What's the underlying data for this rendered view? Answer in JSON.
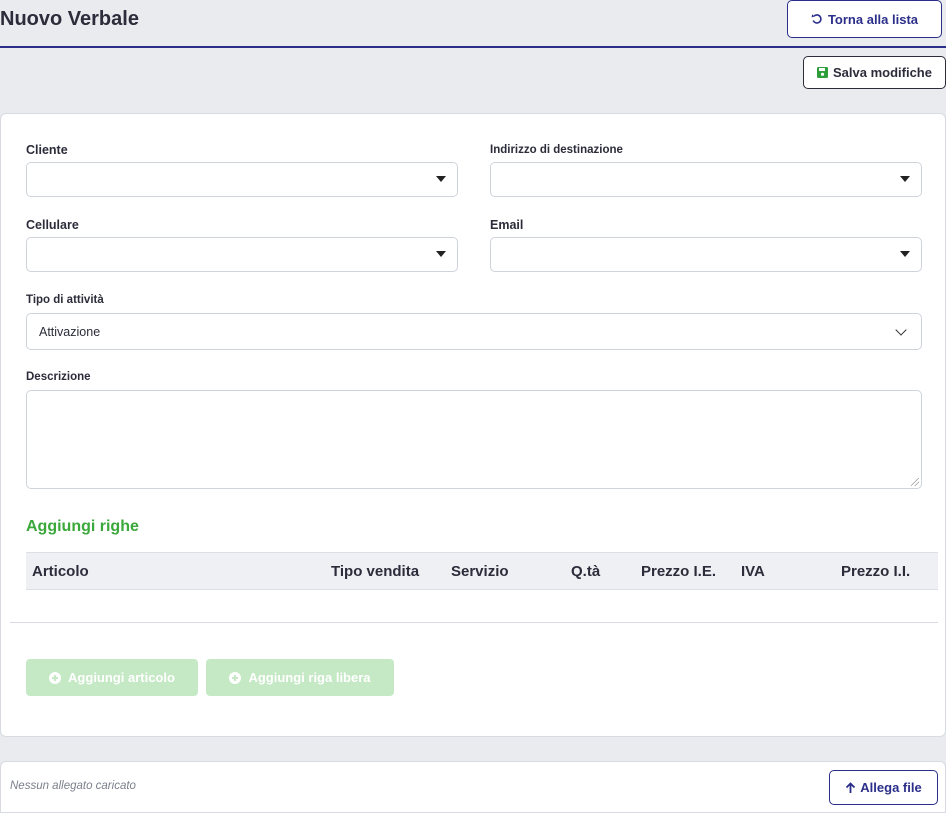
{
  "header": {
    "title": "Nuovo Verbale",
    "back_button": "Torna alla lista",
    "save_button": "Salva modifiche"
  },
  "form": {
    "cliente_label": "Cliente",
    "indirizzo_label": "Indirizzo di destinazione",
    "cellulare_label": "Cellulare",
    "email_label": "Email",
    "tipo_label": "Tipo di attività",
    "tipo_value": "Attivazione",
    "descrizione_label": "Descrizione"
  },
  "righe": {
    "title": "Aggiungi righe",
    "columns": [
      "Articolo",
      "Tipo vendita",
      "Servizio",
      "Q.tà",
      "Prezzo I.E.",
      "IVA",
      "Prezzo I.I."
    ],
    "add_article_button": "Aggiungi articolo",
    "add_free_row_button": "Aggiungi riga libera"
  },
  "attachments": {
    "status": "Nessun allegato caricato",
    "attach_button": "Allega file"
  },
  "colors": {
    "primary": "#2b2f8a",
    "accent_green": "#3aa83a",
    "save_icon_green": "#2e9e3a",
    "disabled_green": "#c5e8c5",
    "background": "#e9ebef"
  },
  "icons": {
    "back": "undo-icon",
    "save": "floppy-disk-icon",
    "add": "plus-circle-icon",
    "attach": "arrow-up-icon",
    "dropdown": "caret-down-icon"
  }
}
